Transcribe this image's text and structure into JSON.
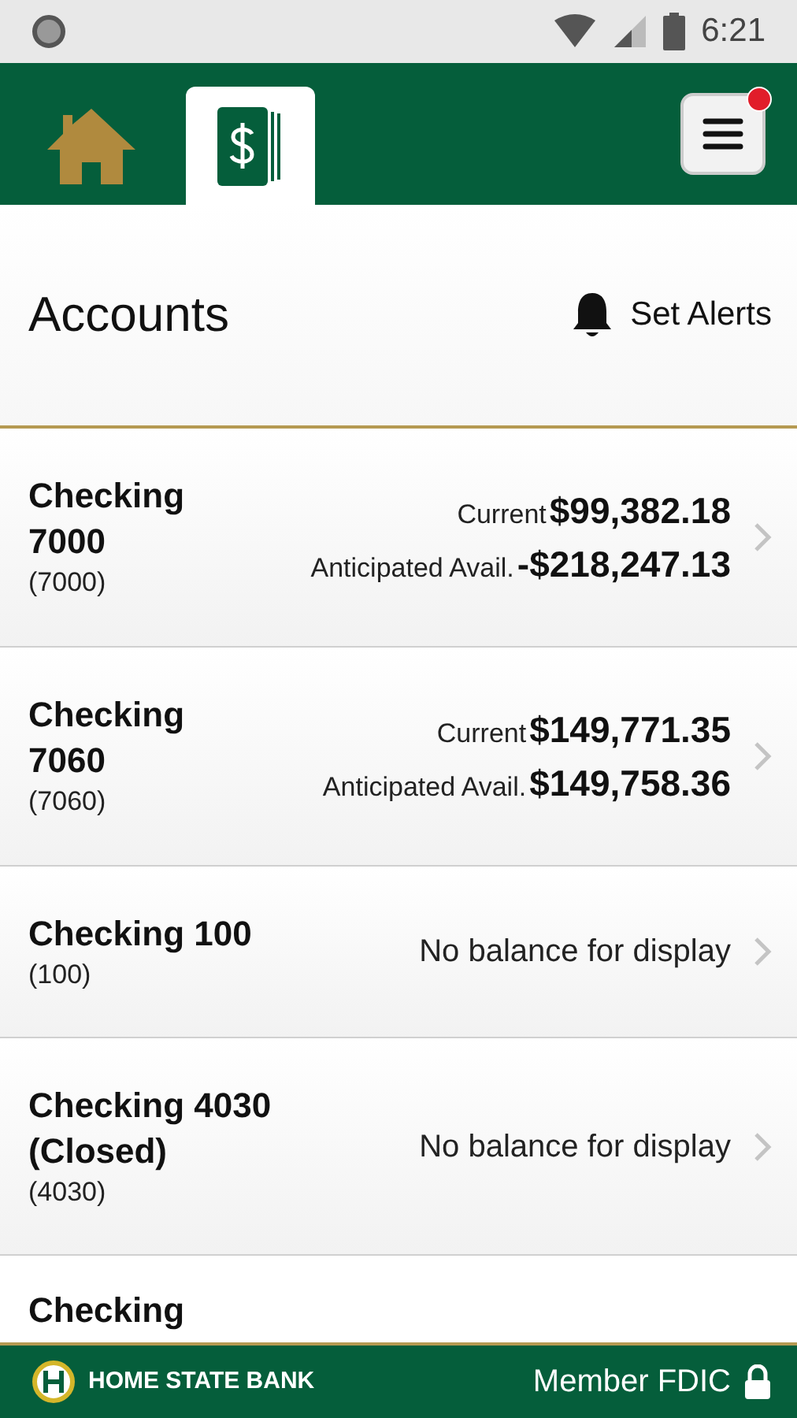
{
  "status_bar": {
    "time": "6:21"
  },
  "nav": {
    "tabs": [
      {
        "kind": "home",
        "selected": false
      },
      {
        "kind": "accounts",
        "selected": true
      }
    ],
    "menu": {
      "notification": true
    }
  },
  "page": {
    "title": "Accounts",
    "alerts_label": "Set Alerts"
  },
  "accounts": [
    {
      "kind": "balance",
      "name": "Checking 7000",
      "number": "(7000)",
      "current_label": "Current",
      "current": "$99,382.18",
      "avail_label": "Anticipated Avail.",
      "avail": "-$218,247.13"
    },
    {
      "kind": "balance",
      "name": "Checking 7060",
      "number": "(7060)",
      "current_label": "Current",
      "current": "$149,771.35",
      "avail_label": "Anticipated Avail.",
      "avail": "$149,758.36"
    },
    {
      "kind": "none",
      "name": "Checking 100",
      "number": "(100)",
      "message": "No balance for display"
    },
    {
      "kind": "none",
      "name": "Checking 4030 (Closed)",
      "number": "(4030)",
      "message": "No balance for display"
    },
    {
      "kind": "partial",
      "name": "Checking"
    }
  ],
  "footer": {
    "bank": "HOME STATE BANK",
    "member": "Member FDIC"
  }
}
